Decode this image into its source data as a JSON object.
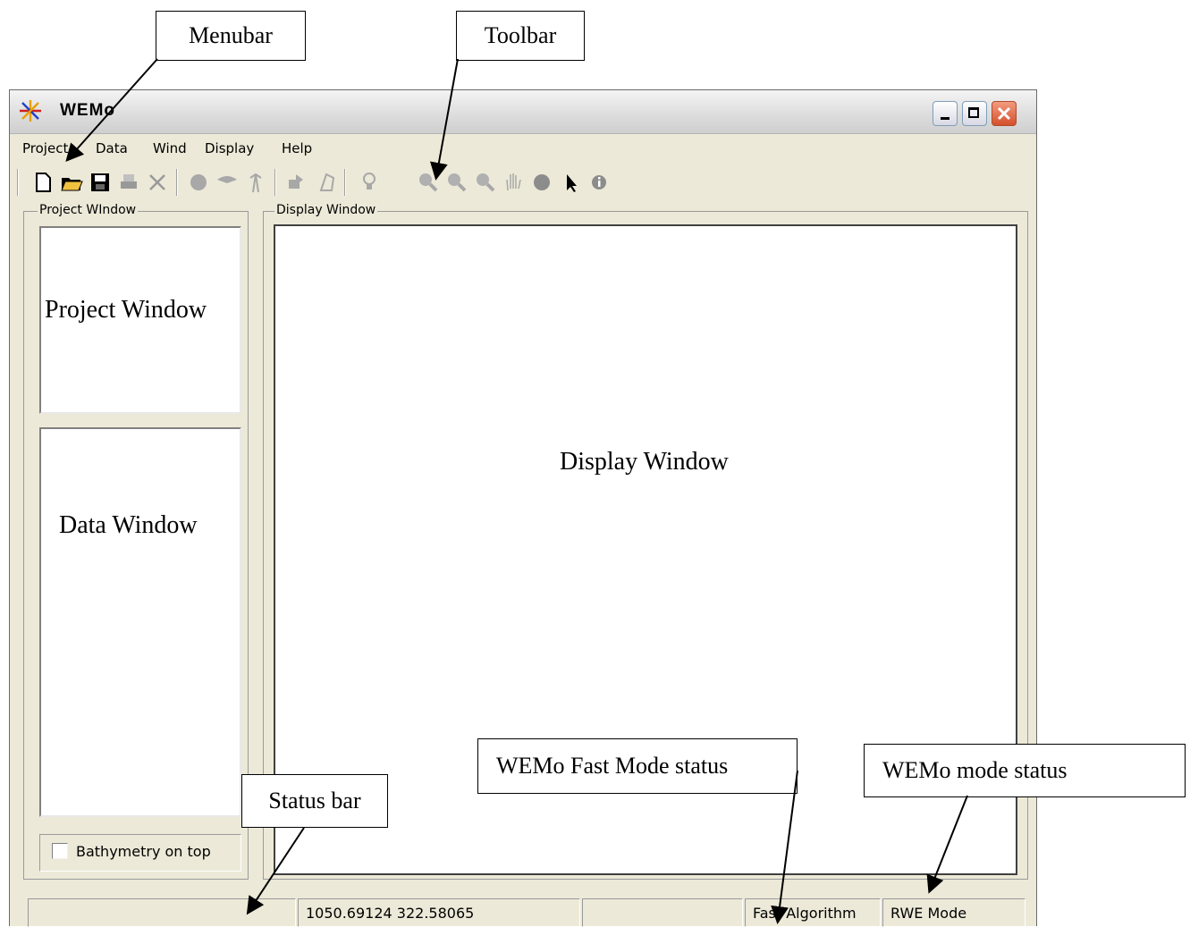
{
  "window": {
    "title": "WEMo",
    "menu": [
      "Project",
      "Data",
      "Wind",
      "Display",
      "Help"
    ]
  },
  "toolbar": {
    "icons": [
      "new-file-icon",
      "open-folder-icon",
      "save-icon",
      "print-icon",
      "delete-icon",
      "grid-icon",
      "wind-icon",
      "tower-icon",
      "import-icon",
      "edit-polygon-icon",
      "run-icon",
      "zoom-in-icon",
      "zoom-out-icon",
      "zoom-extent-icon",
      "pan-hand-icon",
      "globe-icon",
      "pointer-icon",
      "info-icon"
    ]
  },
  "project_window": {
    "legend": "Project WIndow",
    "project_panel_label": "Project Window",
    "data_panel_label": "Data Window",
    "checkbox_label": "Bathymetry on top",
    "checkbox_checked": false
  },
  "display_window": {
    "legend": "Display Window",
    "panel_label": "Display Window"
  },
  "statusbar": {
    "pane1": "",
    "coords": "1050.69124  322.58065",
    "pane3": "",
    "fast_mode": "Fast Algorithm",
    "mode": "RWE Mode"
  },
  "callouts": {
    "menubar": "Menubar",
    "toolbar": "Toolbar",
    "status_bar": "Status bar",
    "fast_mode_status": "WEMo Fast Mode status",
    "mode_status": "WEMo mode status"
  }
}
